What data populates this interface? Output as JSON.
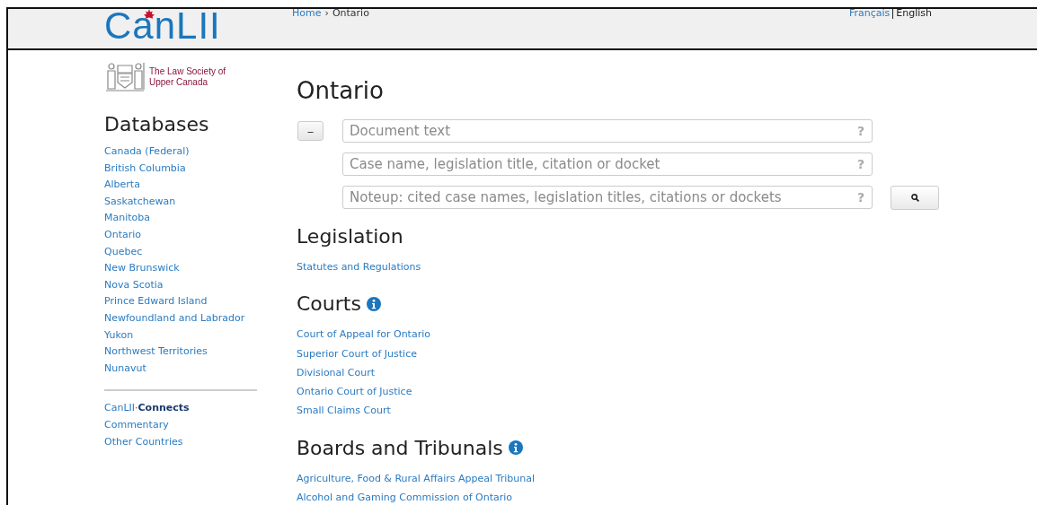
{
  "header": {
    "logo": "CanLII",
    "breadcrumb": [
      {
        "label": "Home",
        "link": true
      },
      {
        "label": "Ontario",
        "link": false
      }
    ],
    "breadcrumb_separator": "›",
    "languages": [
      {
        "label": "Français",
        "selected": false
      },
      {
        "label": "English",
        "selected": true
      }
    ]
  },
  "sidebar": {
    "sponsor": "The Law Society of Upper Canada",
    "title": "Databases",
    "items": [
      "Canada (Federal)",
      "British Columbia",
      "Alberta",
      "Saskatchewan",
      "Manitoba",
      "Ontario",
      "Quebec",
      "New Brunswick",
      "Nova Scotia",
      "Prince Edward Island",
      "Newfoundland and Labrador",
      "Yukon",
      "Northwest Territories",
      "Nunavut"
    ],
    "extra": [
      {
        "kind": "connects",
        "label": "CanLII",
        "dot": "·",
        "bold": "Connects"
      },
      {
        "kind": "link",
        "label": "Commentary"
      },
      {
        "kind": "link",
        "label": "Other Countries"
      }
    ]
  },
  "main": {
    "title": "Ontario",
    "collapse_button": "–",
    "search_fields": [
      {
        "placeholder": "Document text",
        "help": "?"
      },
      {
        "placeholder": "Case name, legislation title, citation or docket",
        "help": "?"
      },
      {
        "placeholder": "Noteup: cited case names, legislation titles, citations or dockets",
        "help": "?"
      }
    ],
    "sections": [
      {
        "title": "Legislation",
        "info": false,
        "links": [
          "Statutes and Regulations"
        ]
      },
      {
        "title": "Courts",
        "info": true,
        "links": [
          "Court of Appeal for Ontario",
          "Superior Court of Justice",
          "Divisional Court",
          "Ontario Court of Justice",
          "Small Claims Court"
        ]
      },
      {
        "title": "Boards and Tribunals",
        "info": true,
        "links": [
          "Agriculture, Food & Rural Affairs Appeal Tribunal",
          "Alcohol and Gaming Commission of Ontario"
        ]
      }
    ]
  }
}
